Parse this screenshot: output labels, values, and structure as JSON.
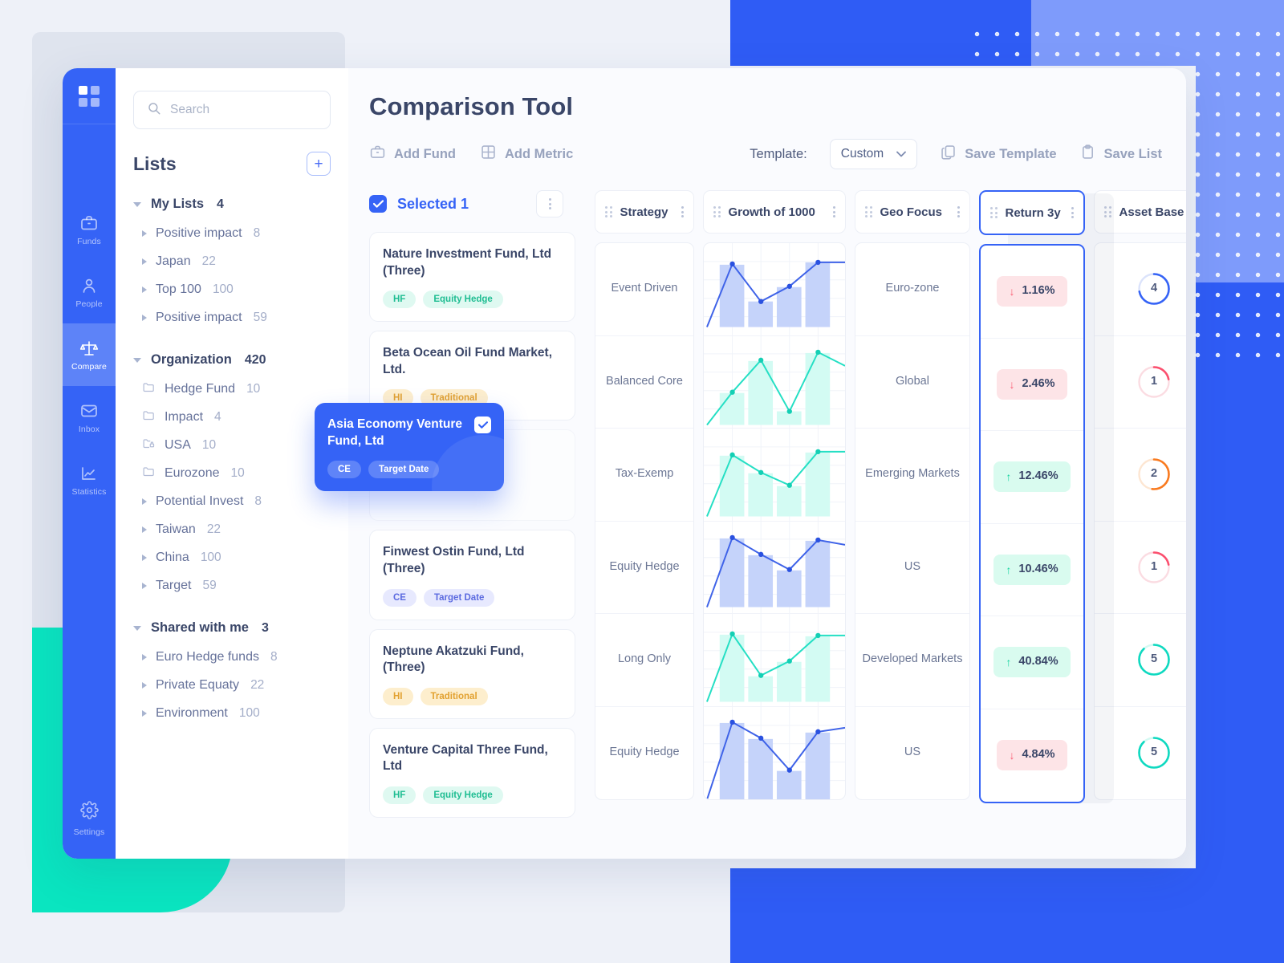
{
  "app": {
    "title": "Comparison Tool"
  },
  "rail": {
    "logo": "grid-logo-icon",
    "items": [
      {
        "label": "Funds",
        "icon": "briefcase-icon",
        "active": false
      },
      {
        "label": "People",
        "icon": "person-icon",
        "active": false
      },
      {
        "label": "Compare",
        "icon": "scales-icon",
        "active": true
      },
      {
        "label": "Inbox",
        "icon": "envelope-icon",
        "active": false
      },
      {
        "label": "Statistics",
        "icon": "chart-line-icon",
        "active": false
      }
    ],
    "settings": {
      "label": "Settings",
      "icon": "gear-icon"
    }
  },
  "search": {
    "placeholder": "Search",
    "value": "",
    "icon": "search-icon"
  },
  "lists": {
    "title": "Lists",
    "add_label": "+",
    "groups": [
      {
        "name": "My Lists",
        "count": "4",
        "expanded": true,
        "items": [
          {
            "label": "Positive impact",
            "count": "8",
            "icon": "caret-right-icon"
          },
          {
            "label": "Japan",
            "count": "22",
            "icon": "caret-right-icon"
          },
          {
            "label": "Top 100",
            "count": "100",
            "icon": "caret-right-icon"
          },
          {
            "label": "Positive impact",
            "count": "59",
            "icon": "caret-right-icon"
          }
        ]
      },
      {
        "name": "Organization",
        "count": "420",
        "expanded": true,
        "items": [
          {
            "label": "Hedge Fund",
            "count": "10",
            "icon": "folder-icon"
          },
          {
            "label": "Impact",
            "count": "4",
            "icon": "folder-icon"
          },
          {
            "label": "USA",
            "count": "10",
            "icon": "folder-lock-icon"
          },
          {
            "label": "Eurozone",
            "count": "10",
            "icon": "folder-icon"
          },
          {
            "label": "Potential Invest",
            "count": "8",
            "icon": "caret-right-icon"
          },
          {
            "label": "Taiwan",
            "count": "22",
            "icon": "caret-right-icon"
          },
          {
            "label": "China",
            "count": "100",
            "icon": "caret-right-icon"
          },
          {
            "label": "Target",
            "count": "59",
            "icon": "caret-right-icon"
          }
        ]
      },
      {
        "name": "Shared with me",
        "count": "3",
        "expanded": true,
        "items": [
          {
            "label": "Euro Hedge funds",
            "count": "8",
            "icon": "caret-right-icon"
          },
          {
            "label": "Private Equaty",
            "count": "22",
            "icon": "caret-right-icon"
          },
          {
            "label": "Environment",
            "count": "100",
            "icon": "caret-right-icon"
          }
        ]
      }
    ]
  },
  "toolbar": {
    "add_fund": "Add Fund",
    "add_fund_icon": "briefcase-icon",
    "add_metric": "Add Metric",
    "add_metric_icon": "grid-table-icon",
    "template_label": "Template:",
    "template_value": "Custom",
    "template_caret_icon": "chevron-down-icon",
    "save_template": "Save Template",
    "save_template_icon": "copy-icon",
    "save_list": "Save List",
    "save_list_icon": "clipboard-icon"
  },
  "funds_panel": {
    "selected_label": "Selected 1",
    "checkbox_icon": "check-icon",
    "menu_icon": "kebab-menu-icon",
    "cards": [
      {
        "name": "Nature Investment Fund, Ltd (Three)",
        "tags": [
          {
            "text": "HF",
            "style": "green"
          },
          {
            "text": "Equity Hedge",
            "style": "green"
          }
        ]
      },
      {
        "name": "Beta Ocean Oil Fund Market, Ltd.",
        "tags": [
          {
            "text": "HI",
            "style": "amber"
          },
          {
            "text": "Traditional",
            "style": "amber"
          }
        ]
      },
      {
        "name": "",
        "tags": [],
        "hidden": true
      },
      {
        "name": "Finwest Ostin Fund, Ltd (Three)",
        "tags": [
          {
            "text": "CE",
            "style": "violet"
          },
          {
            "text": "Target Date",
            "style": "violet"
          }
        ]
      },
      {
        "name": "Neptune Akatzuki Fund, (Three)",
        "tags": [
          {
            "text": "HI",
            "style": "amber"
          },
          {
            "text": "Traditional",
            "style": "amber"
          }
        ]
      },
      {
        "name": "Venture Capital Three Fund, Ltd",
        "tags": [
          {
            "text": "HF",
            "style": "green"
          },
          {
            "text": "Equity Hedge",
            "style": "green"
          }
        ]
      }
    ],
    "popup_card": {
      "name": "Asia Economy Venture Fund, Ltd",
      "checked": true,
      "check_icon": "check-icon",
      "tags": [
        {
          "text": "CE"
        },
        {
          "text": "Target Date"
        }
      ]
    }
  },
  "table": {
    "columns": [
      {
        "key": "strategy",
        "label": "Strategy",
        "grip_icon": "drag-grip-icon",
        "menu_icon": "kebab-menu-icon",
        "highlighted": false
      },
      {
        "key": "growth",
        "label": "Growth of 1000",
        "grip_icon": "drag-grip-icon",
        "menu_icon": "kebab-menu-icon",
        "highlighted": false
      },
      {
        "key": "geo",
        "label": "Geo Focus",
        "grip_icon": "drag-grip-icon",
        "menu_icon": "kebab-menu-icon",
        "highlighted": false
      },
      {
        "key": "return3y",
        "label": "Return 3y",
        "grip_icon": "drag-grip-icon",
        "menu_icon": "kebab-menu-icon",
        "highlighted": true
      },
      {
        "key": "assetbase",
        "label": "Asset Base",
        "grip_icon": "drag-grip-icon",
        "menu_icon": "kebab-menu-icon",
        "highlighted": false
      }
    ],
    "rows": [
      {
        "strategy": "Event Driven",
        "geo": "Euro-zone",
        "return3y": "1.16%",
        "return_dir": "down",
        "asset": "4",
        "asset_color": "#3563f6",
        "asset_pct": 72,
        "chart_color": "blue"
      },
      {
        "strategy": "Balanced Core",
        "geo": "Global",
        "return3y": "2.46%",
        "return_dir": "down",
        "asset": "1",
        "asset_color": "#fb4f6e",
        "asset_pct": 22,
        "chart_color": "teal"
      },
      {
        "strategy": "Tax-Exemp",
        "geo": "Emerging Markets",
        "return3y": "12.46%",
        "return_dir": "up",
        "asset": "2",
        "asset_color": "#f97a1f",
        "asset_pct": 52,
        "chart_color": "teal"
      },
      {
        "strategy": "Equity Hedge",
        "geo": "US",
        "return3y": "10.46%",
        "return_dir": "up",
        "asset": "1",
        "asset_color": "#fb4f6e",
        "asset_pct": 22,
        "chart_color": "blue"
      },
      {
        "strategy": "Long Only",
        "geo": "Developed Markets",
        "return3y": "40.84%",
        "return_dir": "up",
        "asset": "5",
        "asset_color": "#0fd9c0",
        "asset_pct": 88,
        "chart_color": "teal"
      },
      {
        "strategy": "Equity Hedge",
        "geo": "US",
        "return3y": "4.84%",
        "return_dir": "down",
        "asset": "5",
        "asset_color": "#0fd9c0",
        "asset_pct": 88,
        "chart_color": "blue"
      }
    ],
    "arrow_up_glyph": "↑",
    "arrow_down_glyph": "↓"
  },
  "chart_data": {
    "type": "line",
    "title": "Growth of 1000",
    "xlabel": "",
    "ylabel": "",
    "grid": true,
    "legend": "none",
    "x": [
      1,
      2,
      3,
      4,
      5
    ],
    "series": [
      {
        "name": "Event Driven",
        "color": "#3f63e8",
        "values": [
          0,
          78,
          34,
          57,
          83
        ],
        "bars": [
          0,
          78,
          34,
          57,
          83
        ]
      },
      {
        "name": "Balanced Core",
        "color": "#25dfc4",
        "values": [
          0,
          38,
          74,
          12,
          88
        ],
        "bars": [
          0,
          38,
          74,
          12,
          88
        ]
      },
      {
        "name": "Tax-Exemp",
        "color": "#25dfc4",
        "values": [
          0,
          70,
          40,
          28,
          72
        ],
        "bars": [
          0,
          70,
          40,
          28,
          72
        ]
      },
      {
        "name": "Equity Hedge",
        "color": "#3f63e8",
        "values": [
          0,
          82,
          62,
          36,
          79
        ],
        "bars": [
          0,
          82,
          62,
          36,
          79
        ]
      },
      {
        "name": "Long Only",
        "color": "#25dfc4",
        "values": [
          0,
          80,
          26,
          50,
          82
        ],
        "bars": [
          0,
          80,
          26,
          50,
          82
        ]
      },
      {
        "name": "Equity Hedge 2",
        "color": "#3f63e8",
        "values": [
          0,
          83,
          68,
          24,
          74
        ],
        "bars": [
          0,
          83,
          68,
          24,
          74
        ]
      }
    ]
  }
}
